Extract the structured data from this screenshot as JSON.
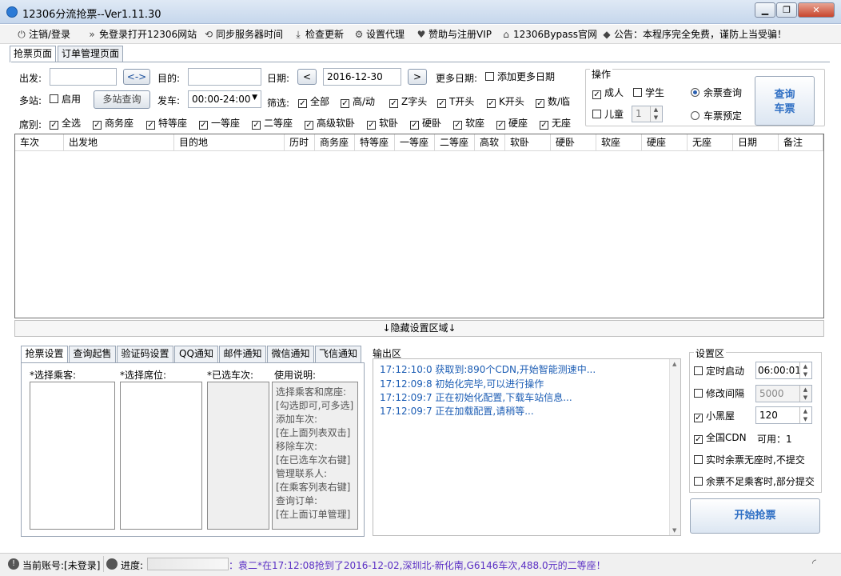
{
  "window": {
    "title": "12306分流抢票--Ver1.11.30",
    "min": "▁",
    "max": "❐",
    "close": "✕"
  },
  "toolbar": {
    "items": [
      {
        "icon": "⏻",
        "label": "注销/登录"
      },
      {
        "icon": "»",
        "label": "免登录打开12306网站"
      },
      {
        "icon": "⟲",
        "label": "同步服务器时间"
      },
      {
        "icon": "⤓",
        "label": "检查更新"
      },
      {
        "icon": "⚙",
        "label": "设置代理"
      },
      {
        "icon": "♥",
        "label": "赞助与注册VIP"
      },
      {
        "icon": "⌂",
        "label": "12306Bypass官网"
      },
      {
        "icon": "◆",
        "label": "公告：本程序完全免费，谨防上当受骗！"
      }
    ]
  },
  "tabs": [
    "抢票页面",
    "订单管理页面"
  ],
  "form": {
    "from_label": "出发:",
    "from_value": "",
    "swap_label": "<->",
    "to_label": "目的:",
    "to_value": "",
    "date_label": "日期:",
    "date_prev": "<",
    "date_value": "2016-12-30",
    "date_next": ">",
    "more_dates_label": "更多日期:",
    "add_more_dates": "添加更多日期",
    "multi_station_label": "多站:",
    "enable_label": "启用",
    "multi_query_button": "多站查询",
    "depart_label": "发车:",
    "depart_value": "00:00-24:00",
    "filter_label": "筛选:",
    "filters": [
      "全部",
      "高/动",
      "Z字头",
      "T开头",
      "K开头",
      "数/临"
    ],
    "seat_label": "席别:",
    "seats": [
      "全选",
      "商务座",
      "特等座",
      "一等座",
      "二等座",
      "高级软卧",
      "软卧",
      "硬卧",
      "软座",
      "硬座",
      "无座"
    ]
  },
  "operations": {
    "group_label": "操作",
    "adult": "成人",
    "student": "学生",
    "child": "儿童",
    "child_count": "1",
    "remaining_query": "余票查询",
    "ticket_booking": "车票预定",
    "query_button_line1": "查询",
    "query_button_line2": "车票"
  },
  "grid": {
    "columns": [
      "车次",
      "出发地",
      "目的地",
      "历时",
      "商务座",
      "特等座",
      "一等座",
      "二等座",
      "高软",
      "软卧",
      "硬卧",
      "软座",
      "硬座",
      "无座",
      "日期",
      "备注"
    ]
  },
  "hide_settings": "↓隐藏设置区域↓",
  "bottom_tabs": [
    "抢票设置",
    "查询起售",
    "验证码设置",
    "QQ通知",
    "邮件通知",
    "微信通知",
    "飞信通知"
  ],
  "grab": {
    "passenger_label": "*选择乘客:",
    "seat_label": "*选择席位:",
    "selected_trains_label": "*已选车次:",
    "instructions_label": "使用说明:",
    "instructions": [
      "选择乘客和席座:",
      "[勾选即可,可多选]",
      "添加车次:",
      "[在上面列表双击]",
      "移除车次:",
      "[在已选车次右键]",
      "管理联系人:",
      "[在乘客列表右键]",
      "查询订单:",
      "[在上面订单管理]"
    ]
  },
  "output": {
    "label": "输出区",
    "logs": [
      "17:12:10:0   获取到:890个CDN,开始智能测速中...",
      "17:12:09:8   初始化完毕,可以进行操作",
      "17:12:09:7   正在初始化配置,下载车站信息...",
      "17:12:09:7   正在加载配置,请稍等..."
    ]
  },
  "settings": {
    "label": "设置区",
    "timed_start": "定时启动",
    "timed_value": "06:00:01",
    "modify_interval": "修改间隔",
    "interval_value": "5000",
    "blackroom": "小黑屋",
    "blackroom_value": "120",
    "national_cdn": "全国CDN",
    "available": "可用：1",
    "no_seat_no_submit": "实时余票无座时,不提交",
    "partial_submit": "余票不足乘客时,部分提交",
    "start_button": "开始抢票"
  },
  "status": {
    "account": "当前账号:[未登录]",
    "progress_label": "进度:",
    "marquee": "：袁二*在17:12:08抢到了2016-12-02,深圳北-新化南,G6146车次,488.0元的二等座！"
  }
}
